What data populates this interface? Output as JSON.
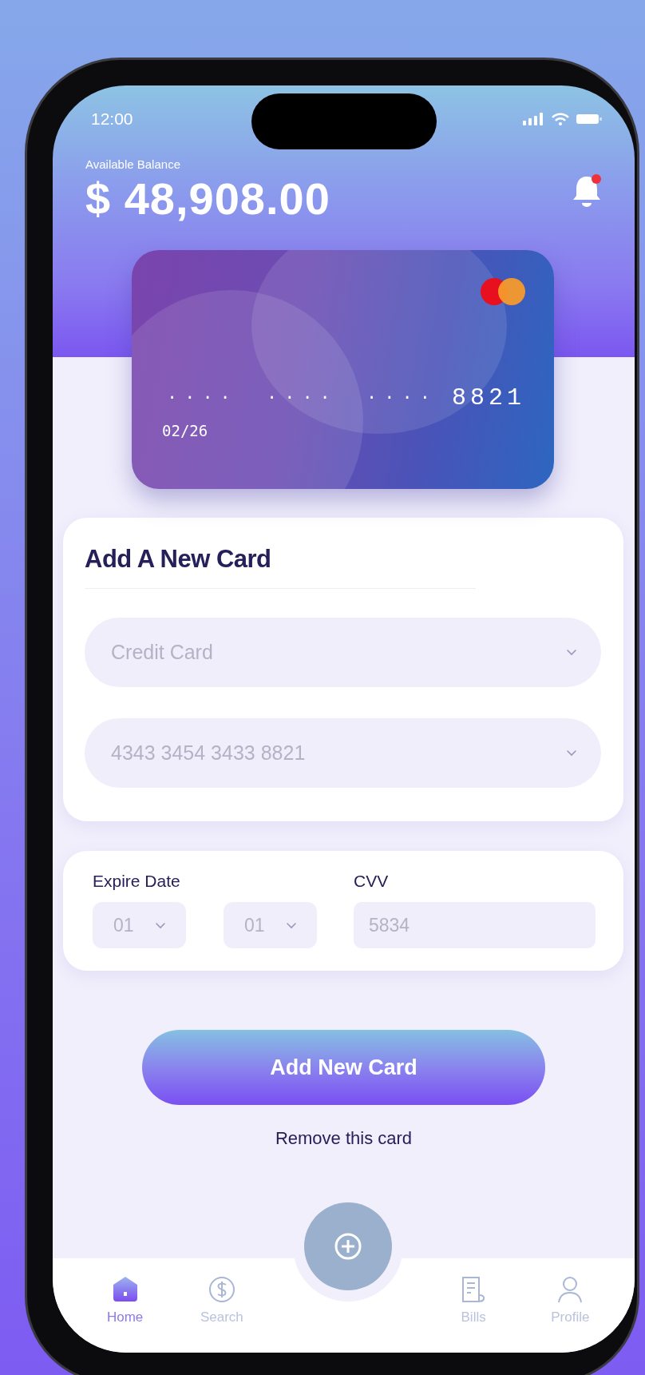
{
  "status_bar": {
    "time": "12:00"
  },
  "header": {
    "balance_label": "Available Balance",
    "balance": "$ 48,908.00",
    "notification": true
  },
  "card": {
    "number_mask": "···· ···· ····",
    "last4": "8821",
    "expiry": "02/26"
  },
  "new_card_form": {
    "title": "Add A New Card",
    "fields": [
      {
        "kind": "select",
        "value": "Credit Card"
      },
      {
        "kind": "select",
        "value": "4343 3454 3433 8821"
      }
    ]
  },
  "expiry": {
    "label": "Expire Date",
    "month": "01",
    "year": "01"
  },
  "cvv": {
    "label": "CVV",
    "value": "5834"
  },
  "primary_button": "Add New Card",
  "link": "Remove this card",
  "tab_bar": [
    {
      "kind": "home",
      "label": "Home",
      "selected": true
    },
    {
      "kind": "dollar",
      "label": "Search",
      "selected": false
    },
    {
      "kind": "fab"
    },
    {
      "kind": "bill",
      "label": "Bills",
      "selected": false
    },
    {
      "kind": "person",
      "label": "Profile",
      "selected": false
    }
  ]
}
